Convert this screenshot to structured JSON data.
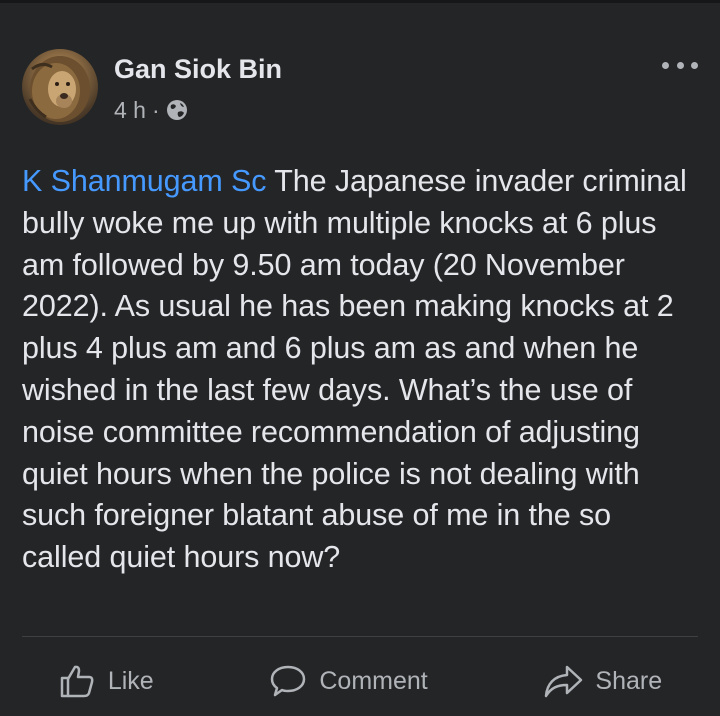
{
  "post": {
    "author": "Gan Siok Bin",
    "time": "4 h",
    "separator": "·",
    "audience_icon": "globe-icon",
    "mention": "K Shanmugam Sc",
    "text": " The Japanese invader criminal bully woke me up with multiple knocks at 6 plus am followed by 9.50 am today (20 November 2022). As usual he has been making knocks at 2 plus 4 plus am and 6 plus am as and when he wished in the last few days. What’s the use of noise committee recommendation of adjusting quiet hours when the police is not dealing with such foreigner blatant abuse of me in the so called quiet hours now?"
  },
  "actions": {
    "like_label": "Like",
    "comment_label": "Comment",
    "share_label": "Share"
  },
  "colors": {
    "background": "#242526",
    "text": "#e4e6eb",
    "secondary": "#b0b3b8",
    "link": "#4599ff"
  }
}
